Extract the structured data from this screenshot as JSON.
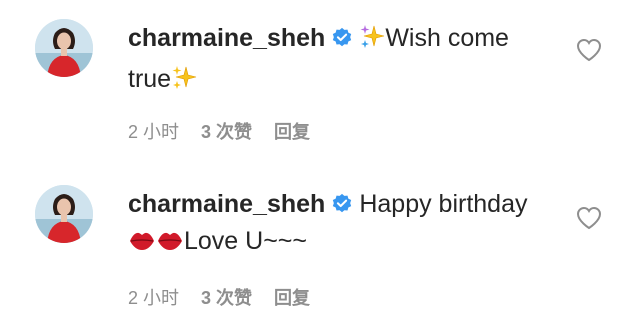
{
  "comments": [
    {
      "username": "charmaine_sheh",
      "text_part1": "Wish come",
      "text_part2": "true",
      "time": "2 小时",
      "likes": "3 次赞",
      "reply": "回复",
      "emoji": "sparkles"
    },
    {
      "username": "charmaine_sheh",
      "text_part1": "Happy birthday",
      "text_part2": "Love U~~~",
      "time": "2 小时",
      "likes": "3 次赞",
      "reply": "回复",
      "emoji": "lips"
    }
  ],
  "colors": {
    "text": "#262626",
    "meta": "#8e8e8e",
    "verified": "#3897f0",
    "heart_outline": "#8e8e8e"
  }
}
